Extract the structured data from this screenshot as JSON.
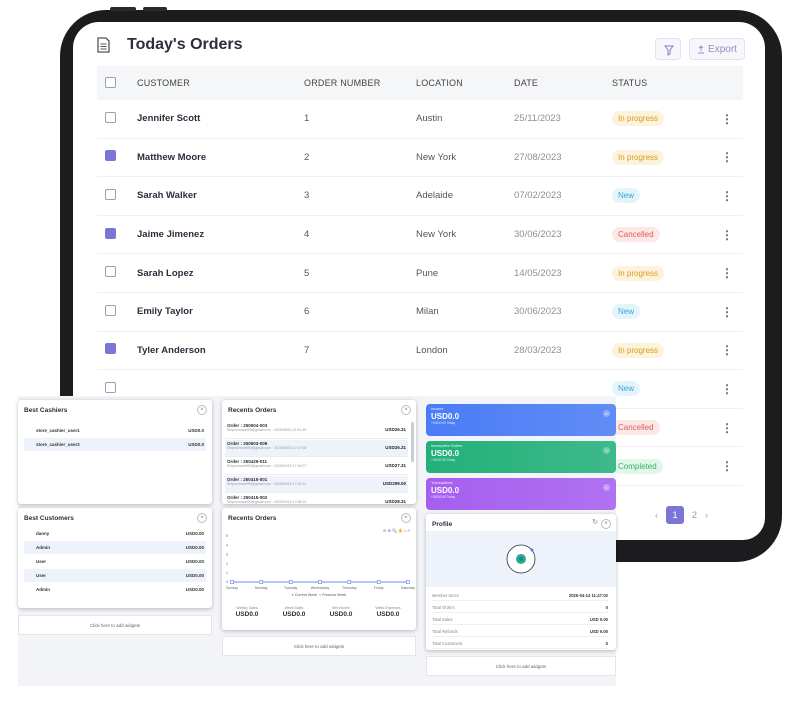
{
  "orders": {
    "title": "Today's Orders",
    "export_label": "Export",
    "columns": [
      "CUSTOMER",
      "ORDER NUMBER",
      "LOCATION",
      "DATE",
      "STATUS"
    ],
    "rows": [
      {
        "checked": false,
        "customer": "Jennifer Scott",
        "number": "1",
        "location": "Austin",
        "date": "25/11/2023",
        "status": "In progress"
      },
      {
        "checked": true,
        "customer": "Matthew Moore",
        "number": "2",
        "location": "New York",
        "date": "27/08/2023",
        "status": "In progress"
      },
      {
        "checked": false,
        "customer": "Sarah Walker",
        "number": "3",
        "location": "Adelaide",
        "date": "07/02/2023",
        "status": "New"
      },
      {
        "checked": true,
        "customer": "Jaime Jimenez",
        "number": "4",
        "location": "New York",
        "date": "30/06/2023",
        "status": "Cancelled"
      },
      {
        "checked": false,
        "customer": "Sarah Lopez",
        "number": "5",
        "location": "Pune",
        "date": "14/05/2023",
        "status": "In progress"
      },
      {
        "checked": false,
        "customer": "Emily Taylor",
        "number": "6",
        "location": "Milan",
        "date": "30/06/2023",
        "status": "New"
      },
      {
        "checked": true,
        "customer": "Tyler Anderson",
        "number": "7",
        "location": "London",
        "date": "28/03/2023",
        "status": "In progress"
      },
      {
        "checked": false,
        "customer": "",
        "number": "",
        "location": "",
        "date": "",
        "status": "New"
      },
      {
        "checked": false,
        "customer": "",
        "number": "",
        "location": "",
        "date": "",
        "status": "Cancelled"
      },
      {
        "checked": false,
        "customer": "",
        "number": "",
        "location": "",
        "date": "",
        "status": "Completed"
      }
    ],
    "pagination": {
      "current": "1",
      "next": "2",
      "prev_icon": "‹",
      "next_icon": "›"
    }
  },
  "status_colors": {
    "In progress": {
      "bg": "#fdf3dc",
      "fg": "#d59b1b"
    },
    "New": {
      "bg": "#e3f4fb",
      "fg": "#3aa3d3"
    },
    "Cancelled": {
      "bg": "#fde8e8",
      "fg": "#e05b5b"
    },
    "Completed": {
      "bg": "#e3f6ea",
      "fg": "#3cae69"
    }
  },
  "widgets": {
    "best_cashiers": {
      "title": "Best Cashiers",
      "items": [
        {
          "name": "store_cashier_user1",
          "value": "USD0.0"
        },
        {
          "name": "store_cashier_user2",
          "value": "USD0.0"
        }
      ]
    },
    "best_customers": {
      "title": "Best Customers",
      "items": [
        {
          "name": "danny",
          "value": "USD0.00"
        },
        {
          "name": "Admin",
          "value": "USD0.00"
        },
        {
          "name": "User",
          "value": "USD0.00"
        },
        {
          "name": "User",
          "value": "USD0.00"
        },
        {
          "name": "Admin",
          "value": "USD0.00"
        }
      ]
    },
    "recent_orders_list": {
      "title": "Recents Orders",
      "items": [
        {
          "id": "Order : 250504-003",
          "sub": "Shiprocman990@gmail.com · 2025/05/04 21:51:45",
          "amount": "USD26.31"
        },
        {
          "id": "Order : 250503-009",
          "sub": "Shiprocman990@gmail.com · 2025/05/03 17:07:58",
          "amount": "USD26.31"
        },
        {
          "id": "Order : 250429-011",
          "sub": "Shiprocman990@gmail.com · 2025/04/29 17:16:07",
          "amount": "USD27.31"
        },
        {
          "id": "Order : 250415-001",
          "sub": "Shiprocman990@gmail.com · 2025/04/15 17:12:11",
          "amount": "USD299.00"
        },
        {
          "id": "Order : 250415-002",
          "sub": "Shiprocman990@gmail.com · 2025/04/15 17:08:13",
          "amount": "USD28.31"
        }
      ]
    },
    "recent_orders_chart": {
      "title": "Recents Orders",
      "legend": [
        "Current Week",
        "Previous Week"
      ],
      "summary": [
        {
          "label": "Weekly Sales",
          "value": "USD0.0"
        },
        {
          "label": "Week Sales",
          "value": "USD0.0"
        },
        {
          "label": "Net Income",
          "value": "USD0.0"
        },
        {
          "label": "Week Expenses",
          "value": "USD0.0"
        }
      ]
    },
    "stats": [
      {
        "label": "Income",
        "value": "USD0.0",
        "sub": "+USD0.00 Today",
        "color": "#4b7cf6"
      },
      {
        "label": "Incomplete Orders",
        "value": "USD0.0",
        "sub": "+USD0.00 Today",
        "color": "#22b07a"
      },
      {
        "label": "Transactions",
        "value": "USD0.0",
        "sub": "+USD0.00 Today",
        "color": "#a55ef0"
      }
    ],
    "profile": {
      "title": "Profile",
      "rows": [
        {
          "k": "Member Since",
          "v": "2025-04-14 11:47:02"
        },
        {
          "k": "Total Orders",
          "v": "0"
        },
        {
          "k": "Total Sales",
          "v": "USD 0.00"
        },
        {
          "k": "Total Refunds",
          "v": "USD 0.00"
        },
        {
          "k": "Total Customers",
          "v": "0"
        }
      ]
    },
    "add_widget_label": "Click here to add widgets"
  },
  "chart_data": {
    "type": "line",
    "categories": [
      "Sunday",
      "Monday",
      "Tuesday",
      "Wednesday",
      "Thursday",
      "Friday",
      "Saturday"
    ],
    "series": [
      {
        "name": "Current Week",
        "values": [
          0,
          0,
          0,
          0,
          0,
          0,
          0
        ],
        "color": "#4b7cf6"
      },
      {
        "name": "Previous Week",
        "values": [
          0,
          0,
          0,
          0,
          0,
          0,
          0
        ],
        "color": "#a8adb8"
      }
    ],
    "ylim": [
      0,
      5
    ],
    "yticks": [
      0,
      1,
      2,
      3,
      4,
      5
    ],
    "legend_position": "bottom"
  }
}
